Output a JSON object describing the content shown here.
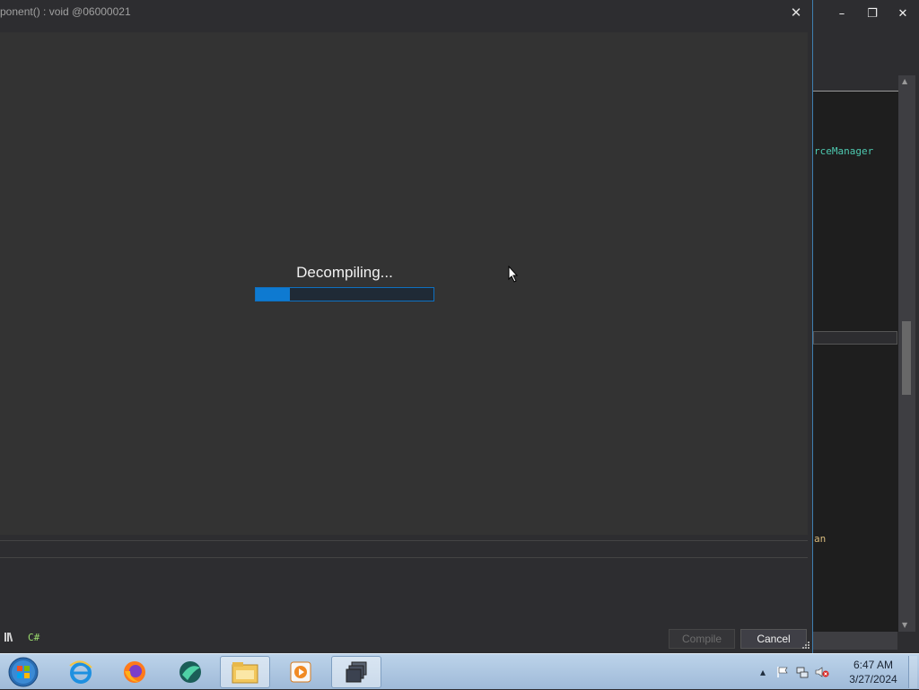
{
  "background_window": {
    "controls": {
      "minimize": "–",
      "restore": "❐",
      "close": "✕"
    },
    "code_fragments": [
      {
        "text": "rceManager",
        "color": "#4ec9b0"
      },
      {
        "text": "an",
        "color": "#d7ba7d"
      }
    ]
  },
  "dialog": {
    "title": "ponent() : void @06000021",
    "close_symbol": "✕",
    "progress": {
      "label": "Decompiling...",
      "fraction": 0.19,
      "fill_color": "#0e7ad1"
    },
    "footer": {
      "language": "C#",
      "compile_label": "Compile",
      "cancel_label": "Cancel"
    }
  },
  "taskbar": {
    "items": [
      {
        "icon": "internet-explorer-icon"
      },
      {
        "icon": "firefox-icon"
      },
      {
        "icon": "app-globe-icon"
      },
      {
        "icon": "file-explorer-icon"
      },
      {
        "icon": "media-player-icon"
      },
      {
        "icon": "windows-stack-icon"
      }
    ],
    "clock_time": "6:47 AM",
    "clock_date": "3/27/2024"
  }
}
